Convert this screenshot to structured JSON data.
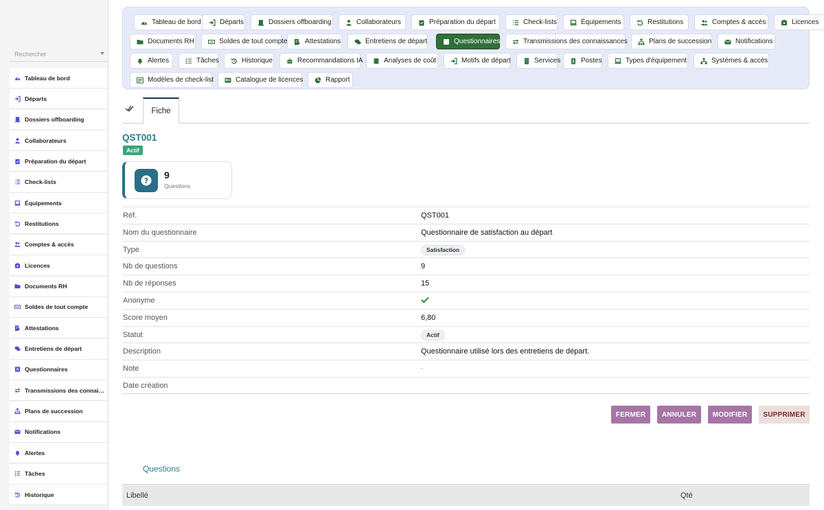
{
  "sidebar": {
    "search_placeholder": "Rechercher",
    "items": [
      {
        "label": "Tableau de bord",
        "icon": "dashboard-icon"
      },
      {
        "label": "Départs",
        "icon": "exit-icon"
      },
      {
        "label": "Dossiers offboarding",
        "icon": "folder-user-icon"
      },
      {
        "label": "Collaborateurs",
        "icon": "user-icon"
      },
      {
        "label": "Préparation du départ",
        "icon": "clipboard-icon"
      },
      {
        "label": "Check-lists",
        "icon": "list-icon"
      },
      {
        "label": "Équipements",
        "icon": "laptop-icon"
      },
      {
        "label": "Restitutions",
        "icon": "undo-icon"
      },
      {
        "label": "Comptes & accès",
        "icon": "users-icon"
      },
      {
        "label": "Licences",
        "icon": "license-icon"
      },
      {
        "label": "Documents RH",
        "icon": "folder-icon"
      },
      {
        "label": "Soldes de tout compte",
        "icon": "money-icon"
      },
      {
        "label": "Attestations",
        "icon": "certificate-icon"
      },
      {
        "label": "Entretiens de départ",
        "icon": "chat-icon"
      },
      {
        "label": "Questionnaires",
        "icon": "form-icon"
      },
      {
        "label": "Transmissions des connaissances",
        "icon": "transfer-icon"
      },
      {
        "label": "Plans de succession",
        "icon": "sitemap-icon"
      },
      {
        "label": "Notifications",
        "icon": "envelope-icon"
      },
      {
        "label": "Alertes",
        "icon": "bell-icon"
      },
      {
        "label": "Tâches",
        "icon": "tasks-icon"
      },
      {
        "label": "Historique",
        "icon": "history-icon"
      }
    ]
  },
  "nav": {
    "chips": [
      {
        "label": "Tableau de bord",
        "icon": "dashboard-icon"
      },
      {
        "label": "Départs",
        "icon": "exit-icon"
      },
      {
        "label": "Dossiers offboarding",
        "icon": "folder-user-icon"
      },
      {
        "label": "Collaborateurs",
        "icon": "user-icon"
      },
      {
        "label": "Préparation du départ",
        "icon": "clipboard-icon"
      },
      {
        "label": "Check-lists",
        "icon": "list-icon"
      },
      {
        "label": "Équipements",
        "icon": "laptop-icon"
      },
      {
        "label": "Restitutions",
        "icon": "undo-icon"
      },
      {
        "label": "Comptes & accès",
        "icon": "users-icon"
      },
      {
        "label": "Licences",
        "icon": "license-icon"
      },
      {
        "label": "Documents RH",
        "icon": "folder-icon"
      },
      {
        "label": "Soldes de tout compte",
        "icon": "money-icon"
      },
      {
        "label": "Attestations",
        "icon": "certificate-icon"
      },
      {
        "label": "Entretiens de départ",
        "icon": "chat-icon"
      },
      {
        "label": "Questionnaires",
        "icon": "form-icon",
        "active": true
      },
      {
        "label": "Transmissions des connaissances",
        "icon": "transfer-icon"
      },
      {
        "label": "Plans de succession",
        "icon": "sitemap-icon"
      },
      {
        "label": "Notifications",
        "icon": "envelope-icon"
      },
      {
        "label": "Alertes",
        "icon": "bell-icon"
      },
      {
        "label": "Tâches",
        "icon": "tasks-icon"
      },
      {
        "label": "Historique",
        "icon": "history-icon"
      },
      {
        "label": "Recommandations IA",
        "icon": "robot-icon"
      },
      {
        "label": "Analyses de coût",
        "icon": "coins-icon"
      },
      {
        "label": "Motifs de départ",
        "icon": "exit-icon"
      },
      {
        "label": "Services",
        "icon": "building-icon"
      },
      {
        "label": "Postes",
        "icon": "badge-icon"
      },
      {
        "label": "Types d'équipement",
        "icon": "laptop-icon"
      },
      {
        "label": "Systèmes & accès",
        "icon": "network-icon"
      },
      {
        "label": "Modèles de check-list",
        "icon": "template-icon"
      },
      {
        "label": "Catalogue de licences",
        "icon": "catalog-icon"
      },
      {
        "label": "Rapport",
        "icon": "pie-chart-icon"
      }
    ]
  },
  "tabs": {
    "fiche": "Fiche"
  },
  "record": {
    "title": "QST001",
    "status_badge": "Actif",
    "stat": {
      "value": "9",
      "label": "Questions",
      "icon": "question-icon"
    },
    "fields": [
      {
        "key": "Réf.",
        "value": "QST001",
        "type": "text"
      },
      {
        "key": "Nom du questionnaire",
        "value": "Questionnaire de satisfaction au départ",
        "type": "text"
      },
      {
        "key": "Type",
        "value": "Satisfaction",
        "type": "pill"
      },
      {
        "key": "Nb de questions",
        "value": "9",
        "type": "text"
      },
      {
        "key": "Nb de réponses",
        "value": "15",
        "type": "text"
      },
      {
        "key": "Anonyme",
        "value": "",
        "type": "check"
      },
      {
        "key": "Score moyen",
        "value": "6,80",
        "type": "text"
      },
      {
        "key": "Statut",
        "value": "Actif",
        "type": "pill"
      },
      {
        "key": "Description",
        "value": "Questionnaire utilisé lors des entretiens de départ.",
        "type": "text"
      },
      {
        "key": "Note",
        "value": "-",
        "type": "muted"
      },
      {
        "key": "Date création",
        "value": "",
        "type": "text"
      }
    ]
  },
  "actions": {
    "close": "FERMER",
    "cancel": "ANNULER",
    "edit": "MODIFIER",
    "delete": "SUPPRIMER"
  },
  "questions": {
    "title": "Questions",
    "col_label": "Libellé",
    "col_qty": "Qté"
  },
  "colors": {
    "accent_teal": "#2a7f86",
    "active_green": "#2f6f3a",
    "button_purple": "#a675a6",
    "sidebar_icon": "#4a4fd0",
    "check_green": "#2e8b3a"
  }
}
